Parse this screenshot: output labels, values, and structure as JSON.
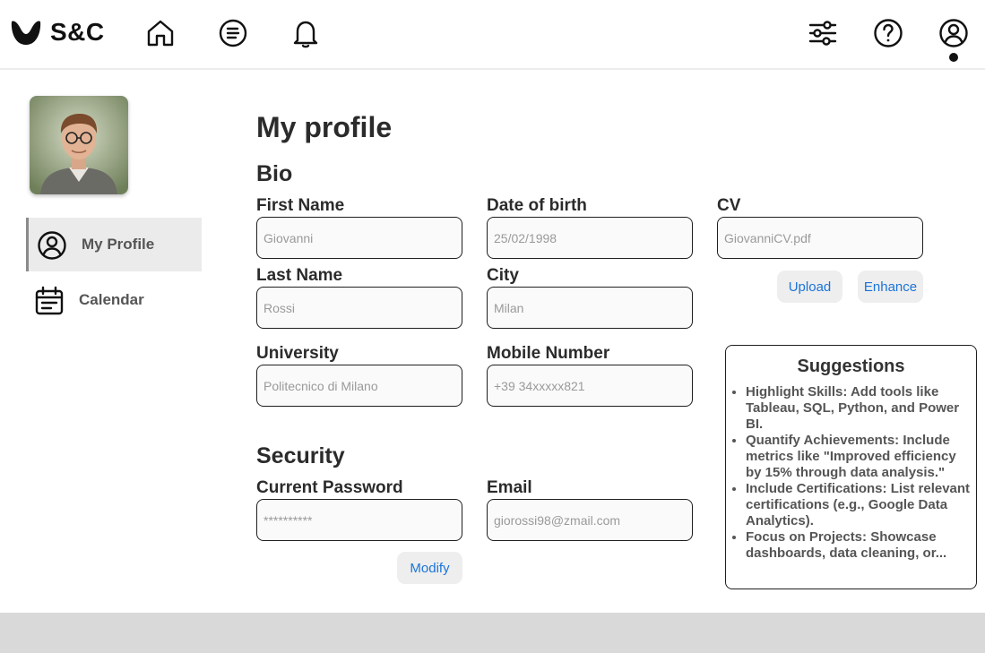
{
  "header": {
    "brand": "S&C",
    "icons": [
      "home-icon",
      "notes-icon",
      "bell-icon",
      "sliders-icon",
      "help-icon",
      "profile-icon"
    ]
  },
  "sidebar": {
    "items": [
      {
        "label": "My Profile",
        "icon": "profile-icon",
        "active": true
      },
      {
        "label": "Calendar",
        "icon": "calendar-icon",
        "active": false
      }
    ]
  },
  "main": {
    "title": "My profile",
    "bio": {
      "heading": "Bio",
      "first_name": {
        "label": "First Name",
        "placeholder": "Giovanni"
      },
      "last_name": {
        "label": "Last Name",
        "placeholder": "Rossi"
      },
      "university": {
        "label": "University",
        "placeholder": "Politecnico di Milano"
      },
      "date_of_birth": {
        "label": "Date of birth",
        "placeholder": "25/02/1998"
      },
      "city": {
        "label": "City",
        "placeholder": "Milan"
      },
      "mobile": {
        "label": "Mobile Number",
        "placeholder": "+39 34xxxxx821"
      },
      "cv": {
        "label": "CV",
        "placeholder": "GiovanniCV.pdf"
      },
      "upload_label": "Upload",
      "enhance_label": "Enhance"
    },
    "security": {
      "heading": "Security",
      "password": {
        "label": "Current Password",
        "placeholder": "**********"
      },
      "email": {
        "label": "Email",
        "placeholder": "giorossi98@zmail.com"
      },
      "modify_label": "Modify"
    }
  },
  "suggestions": {
    "title": "Suggestions",
    "items": [
      "Highlight Skills: Add tools like Tableau, SQL, Python, and Power BI.",
      "Quantify Achievements: Include metrics like \"Improved efficiency by 15% through data analysis.\"",
      "Include Certifications: List relevant certifications (e.g., Google Data Analytics).",
      "Focus on Projects: Showcase dashboards, data cleaning, or..."
    ]
  },
  "colors": {
    "accent": "#1b74d8",
    "button_bg": "#eeeeee",
    "active_item_bg": "#ebebeb",
    "footer": "#d9d9d9"
  }
}
